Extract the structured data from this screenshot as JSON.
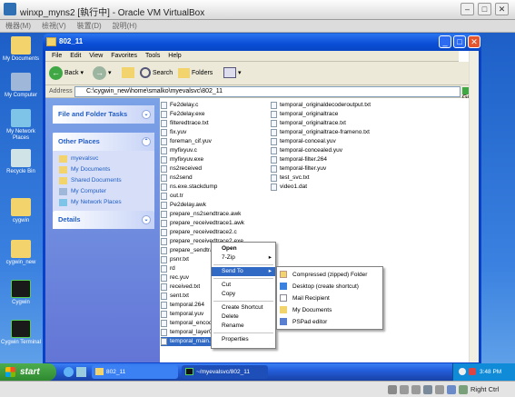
{
  "vbox": {
    "title": "winxp_myns2 [執行中] - Oracle VM VirtualBox",
    "menu": [
      "機器(M)",
      "檢視(V)",
      "裝置(D)",
      "說明(H)"
    ],
    "host_key": "Right Ctrl"
  },
  "desktop": {
    "icons": [
      "My Documents",
      "My Computer",
      "My Network Places",
      "Recycle Bin",
      "cygwin",
      "cygwin_new",
      "Cygwin",
      "Cygwin Terminal"
    ]
  },
  "window": {
    "title": "802_11",
    "menu": [
      "File",
      "Edit",
      "View",
      "Favorites",
      "Tools",
      "Help"
    ],
    "toolbar": {
      "back": "Back",
      "search": "Search",
      "folders": "Folders"
    },
    "address": {
      "label": "Address",
      "value": "C:\\cygwin_new\\home\\smalko\\myevalsvc\\802_11",
      "go": "Go"
    }
  },
  "sidebar": {
    "file_tasks": "File and Folder Tasks",
    "other_places": {
      "title": "Other Places",
      "items": [
        "myevalsvc",
        "My Documents",
        "Shared Documents",
        "My Computer",
        "My Network Places"
      ]
    },
    "details": "Details"
  },
  "files": {
    "col1": [
      "Fe2delay.c",
      "Fe2delay.exe",
      "filteredtrace.txt",
      "fix.yuv",
      "foreman_cif.yuv",
      "myfixyuv.c",
      "myfixyuv.exe",
      "ns2received",
      "ns2send",
      "ns.exe.stackdump",
      "out.tr",
      "Pe2delay.awk",
      "prepare_ns2sendtrace.awk",
      "prepare_receivedtrace1.awk",
      "prepare_receivedtrace2.c",
      "prepare_receivedtrace2.exe",
      "prepare_sendtrace.awk",
      "psnr.txt",
      "rd",
      "rec.yuv",
      "received.txt",
      "sent.txt",
      "temporal.264",
      "temporal.yuv",
      "temporal_encoding",
      "temporal_layer0.txt",
      "temporal_main.c"
    ],
    "col2": [
      "temporal_originaldecoderoutput.txt",
      "temporal_originaltrace",
      "temporal_originaltrace.txt",
      "temporal_originaltrace-frameno.txt",
      "temporal-conceal.yuv",
      "temporal-concealed.yuv",
      "temporal-filter.264",
      "temporal-filter.yuv",
      "test_svc.txt",
      "video1.dat"
    ],
    "selected": "temporal_main.c"
  },
  "context_menu": {
    "items": [
      "Open",
      "7-Zip",
      "Send To",
      "Cut",
      "Copy",
      "Create Shortcut",
      "Delete",
      "Rename",
      "Properties"
    ]
  },
  "sendto_menu": {
    "items": [
      "Compressed (zipped) Folder",
      "Desktop (create shortcut)",
      "Mail Recipient",
      "My Documents",
      "PSPad editor"
    ]
  },
  "taskbar": {
    "start": "start",
    "tasks": [
      "802_11",
      "~/myevalsvc/802_11"
    ],
    "clock": "3:48 PM"
  }
}
